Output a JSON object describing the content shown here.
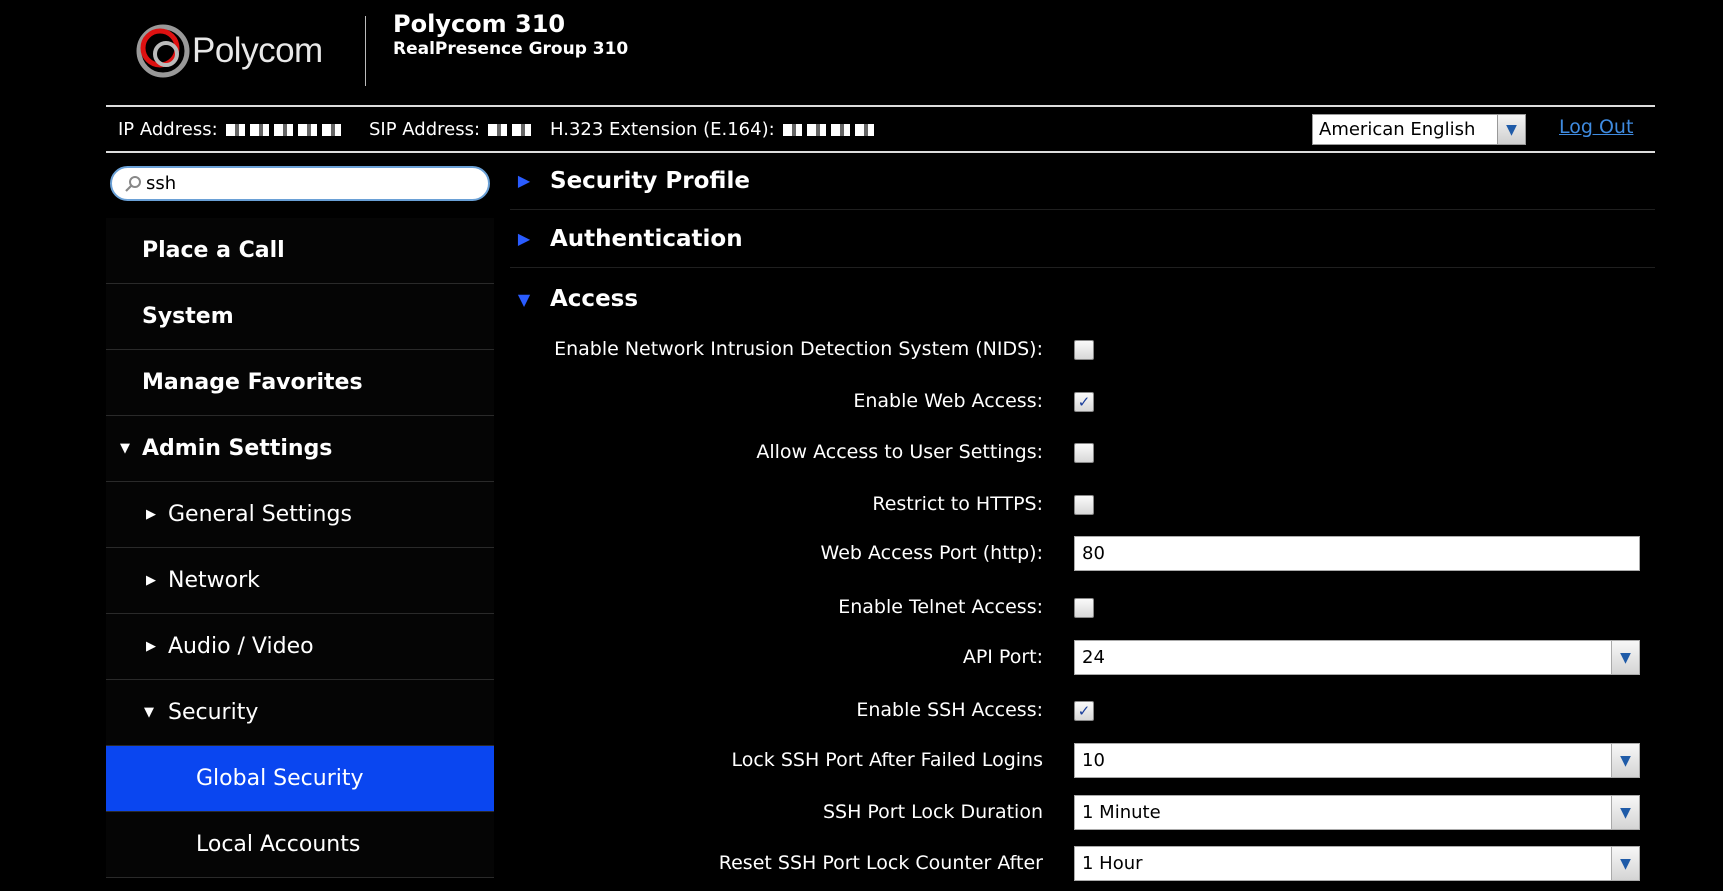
{
  "header": {
    "logo_text": "Polycom",
    "title": "Polycom 310",
    "subtitle": "RealPresence Group 310"
  },
  "infobar": {
    "ip_label": "IP Address:",
    "sip_label": "SIP Address:",
    "h323_label": "H.323 Extension (E.164):",
    "language": "American English",
    "logout": "Log Out"
  },
  "search": {
    "value": "ssh",
    "icon": "search-icon"
  },
  "sidebar": {
    "items": [
      {
        "label": "Place a Call",
        "level": 0
      },
      {
        "label": "System",
        "level": 0
      },
      {
        "label": "Manage Favorites",
        "level": 0
      },
      {
        "label": "Admin Settings",
        "level": 0,
        "expanded": true
      },
      {
        "label": "General Settings",
        "level": 1,
        "expanded": false
      },
      {
        "label": "Network",
        "level": 1,
        "expanded": false
      },
      {
        "label": "Audio / Video",
        "level": 1,
        "expanded": false
      },
      {
        "label": "Security",
        "level": 1,
        "expanded": true
      },
      {
        "label": "Global Security",
        "level": 2,
        "active": true
      },
      {
        "label": "Local Accounts",
        "level": 2
      }
    ]
  },
  "sections": [
    {
      "label": "Security Profile",
      "expanded": false
    },
    {
      "label": "Authentication",
      "expanded": false
    },
    {
      "label": "Access",
      "expanded": true
    }
  ],
  "access": {
    "nids_label": "Enable Network Intrusion Detection System (NIDS):",
    "nids_checked": false,
    "web_access_label": "Enable Web Access:",
    "web_access_checked": true,
    "user_settings_label": "Allow Access to User Settings:",
    "user_settings_checked": false,
    "https_label": "Restrict to HTTPS:",
    "https_checked": false,
    "web_port_label": "Web Access Port (http):",
    "web_port_value": "80",
    "telnet_label": "Enable Telnet Access:",
    "telnet_checked": false,
    "api_port_label": "API Port:",
    "api_port_value": "24",
    "ssh_label": "Enable SSH Access:",
    "ssh_checked": true,
    "ssh_lock_label": "Lock SSH Port After Failed Logins",
    "ssh_lock_value": "10",
    "ssh_duration_label": "SSH Port Lock Duration",
    "ssh_duration_value": "1 Minute",
    "ssh_reset_label": "Reset SSH Port Lock Counter After",
    "ssh_reset_value": "1 Hour"
  },
  "colors": {
    "accent": "#0a46f0",
    "link": "#3f8be0",
    "chevron": "#2a5cff"
  }
}
